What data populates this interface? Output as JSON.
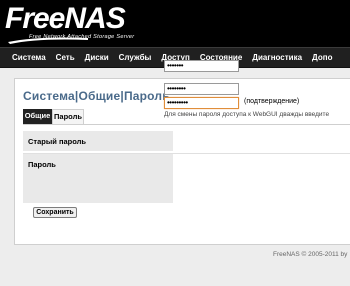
{
  "header": {
    "logo_text": "FreeNAS",
    "tagline": "Free Network Attached Storage Server"
  },
  "nav": {
    "items": [
      "Система",
      "Сеть",
      "Диски",
      "Службы",
      "Доступ",
      "Состояние",
      "Диагностика",
      "Допо"
    ]
  },
  "page": {
    "title": "Система|Общие|Пароль"
  },
  "tabs": {
    "general": "Общие",
    "password": "Пароль"
  },
  "form": {
    "old_password_label": "Старый пароль",
    "old_password_value": "•••••••",
    "new_password_label": "Пароль",
    "new_password_value": "••••••••",
    "confirm_password_value": "•••••••••",
    "confirm_label": "(подтверждение)",
    "hint": "Для смены пароля доступа к WebGUI дважды введите"
  },
  "buttons": {
    "save": "Сохранить"
  },
  "footer": {
    "text": "FreeNAS © 2005-2011 by"
  },
  "colors": {
    "header_bg": "#000000",
    "nav_bg": "#202020",
    "title_color": "#4a6a8a",
    "focus_border": "#e08e3a"
  }
}
